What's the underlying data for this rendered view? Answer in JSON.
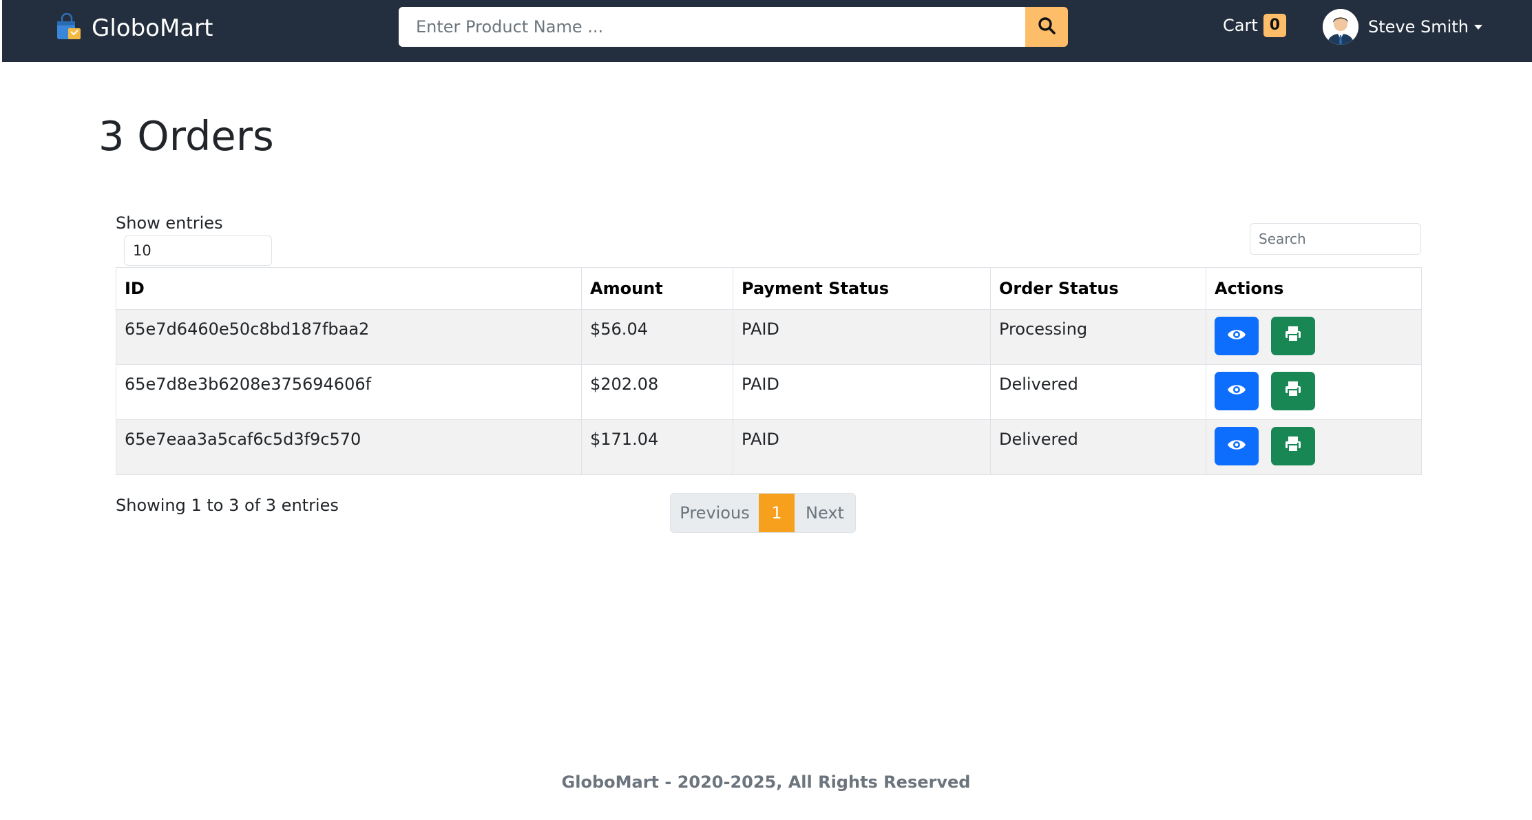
{
  "navbar": {
    "brand": "GloboMart",
    "search_placeholder": "Enter Product Name ...",
    "cart_label": "Cart",
    "cart_count": "0",
    "user_name": "Steve Smith"
  },
  "page": {
    "title": "3 Orders"
  },
  "table_controls": {
    "show_entries_label": "Show entries",
    "entries_value": "10",
    "search_placeholder": "Search"
  },
  "table": {
    "headers": [
      "ID",
      "Amount",
      "Payment Status",
      "Order Status",
      "Actions"
    ],
    "rows": [
      {
        "id": "65e7d6460e50c8bd187fbaa2",
        "amount": "$56.04",
        "payment_status": "PAID",
        "order_status": "Processing"
      },
      {
        "id": "65e7d8e3b6208e375694606f",
        "amount": "$202.08",
        "payment_status": "PAID",
        "order_status": "Delivered"
      },
      {
        "id": "65e7eaa3a5caf6c5d3f9c570",
        "amount": "$171.04",
        "payment_status": "PAID",
        "order_status": "Delivered"
      }
    ],
    "action_icons": [
      "eye-icon",
      "print-icon"
    ]
  },
  "table_footer": {
    "info": "Showing 1 to 3 of 3 entries",
    "previous": "Previous",
    "current_page": "1",
    "next": "Next"
  },
  "footer": {
    "text": "GloboMart - 2020-2025, All Rights Reserved"
  },
  "colors": {
    "navbar": "#232f3e",
    "accent": "#febd69",
    "active_page": "#f7a01d",
    "view_button": "#0d6efd",
    "print_button": "#198754"
  }
}
